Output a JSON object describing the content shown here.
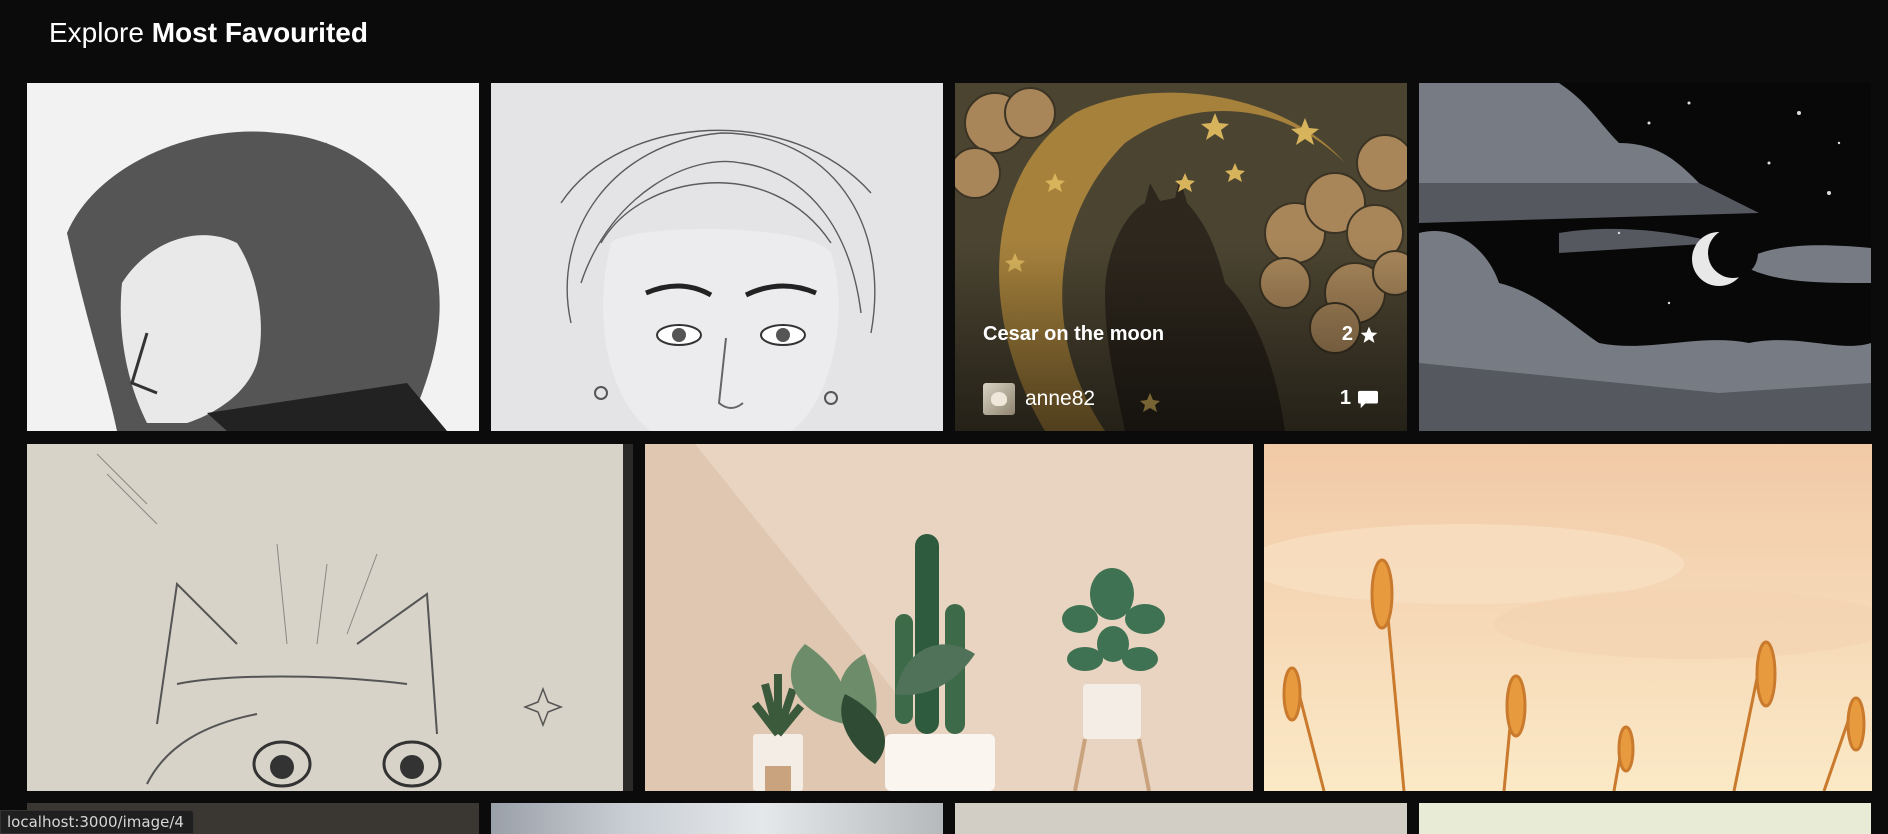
{
  "header": {
    "prefix": "Explore",
    "title": "Most Favourited"
  },
  "hovered_card": {
    "title": "Cesar on the moon",
    "favourites": "2",
    "username": "anne82",
    "comments": "1",
    "icons": {
      "favourites": "star-icon",
      "comments": "comment-icon"
    }
  },
  "gallery": {
    "items": [
      {
        "name": "sketch-man-profile"
      },
      {
        "name": "sketch-woman-portrait"
      },
      {
        "name": "cat-on-moon-illustration"
      },
      {
        "name": "pixel-night-sky-moon"
      },
      {
        "name": "sketch-cat"
      },
      {
        "name": "plants-illustration"
      },
      {
        "name": "wheat-sunset-painting"
      }
    ]
  },
  "status_bar": {
    "url": "localhost:3000/image/4"
  }
}
